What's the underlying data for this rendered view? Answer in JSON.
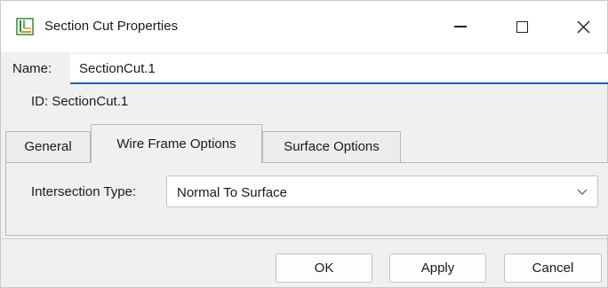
{
  "window": {
    "title": "Section Cut Properties",
    "icon": "section-cut-app-icon",
    "minimize_icon": "minimize-icon",
    "maximize_icon": "maximize-icon",
    "close_icon": "close-icon"
  },
  "form": {
    "name_label": "Name:",
    "name_value": "SectionCut.1",
    "id_line": "ID: SectionCut.1"
  },
  "tabs": [
    {
      "label": "General",
      "active": false
    },
    {
      "label": "Wire Frame Options",
      "active": true
    },
    {
      "label": "Surface Options",
      "active": false
    }
  ],
  "wire_frame": {
    "intersection_label": "Intersection Type:",
    "intersection_value": "Normal To Surface",
    "chevron_icon": "chevron-down-icon"
  },
  "buttons": {
    "ok": "OK",
    "apply": "Apply",
    "cancel": "Cancel"
  },
  "colors": {
    "accent": "#1f5fb4",
    "icon_green": "#2e8b3a",
    "icon_gold": "#c89a1c"
  }
}
